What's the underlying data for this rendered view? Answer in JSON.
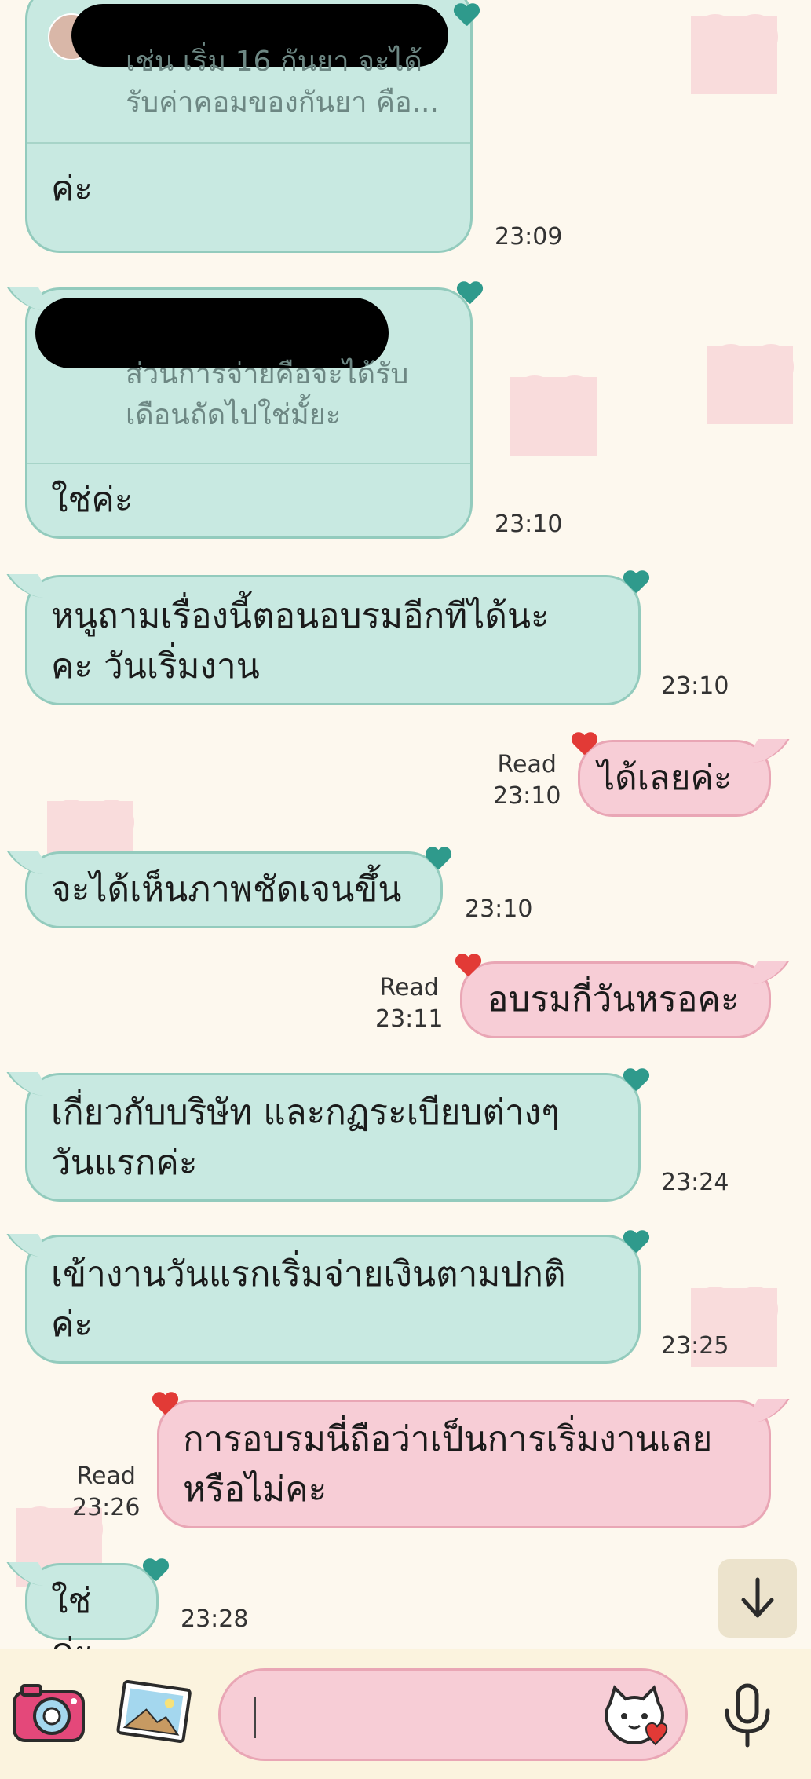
{
  "messages": [
    {
      "id": "m1",
      "side": "in",
      "quoted_text": "เช่น เริ่ม 16 กันยา จะได้\nรับค่าคอมของกันยา คือ...",
      "text": "ค่ะ",
      "time": "23:09"
    },
    {
      "id": "m2",
      "side": "in",
      "quoted_text": "ส่วนการจ่ายคือจะได้รับ\nเดือนถัดไปใช่มั้ยะ",
      "text": "ใช่ค่ะ",
      "time": "23:10"
    },
    {
      "id": "m3",
      "side": "in",
      "text": "หนูถามเรื่องนี้ตอนอบรมอีกทีได้นะ\nคะ วันเริ่มงาน",
      "time": "23:10"
    },
    {
      "id": "m4",
      "side": "out",
      "text": "ได้เลยค่ะ",
      "status": "Read",
      "time": "23:10"
    },
    {
      "id": "m5",
      "side": "in",
      "text": "จะได้เห็นภาพชัดเจนขึ้น",
      "time": "23:10"
    },
    {
      "id": "m6",
      "side": "out",
      "text": "อบรมกี่วันหรอคะ",
      "status": "Read",
      "time": "23:11"
    },
    {
      "id": "m7",
      "side": "in",
      "text": "เกี่ยวกับบริษัท และกฏระเบียบต่างๆ\nวันแรกค่ะ",
      "time": "23:24"
    },
    {
      "id": "m8",
      "side": "in",
      "text": "เข้างานวันแรกเริ่มจ่ายเงินตามปกติ\nค่ะ",
      "time": "23:25"
    },
    {
      "id": "m9",
      "side": "out",
      "text": "การอบรมนี่ถือว่าเป็นการเริ่มงานเลย\nหรือไม่คะ",
      "status": "Read",
      "time": "23:26"
    },
    {
      "id": "m10",
      "side": "in",
      "text": "ใช่ค่ะ",
      "time": "23:28"
    }
  ],
  "input_bar": {
    "placeholder": "",
    "icons": [
      "camera-icon",
      "gallery-icon",
      "sticker-icon",
      "mic-icon"
    ]
  },
  "scroll_button": {
    "icon": "arrow-down-icon"
  },
  "colors": {
    "incoming_bubble": "#c8e9e1",
    "outgoing_bubble": "#f7cdd6",
    "background": "#fdf8ee",
    "input_bar": "#fbf3de"
  }
}
